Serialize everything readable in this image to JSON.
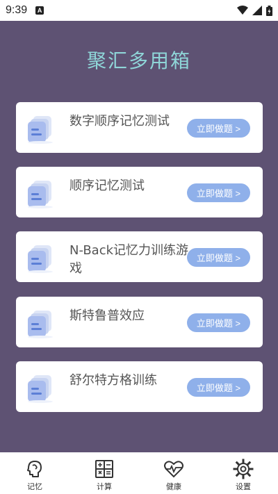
{
  "status": {
    "time": "9:39",
    "app_icon_letter": "A"
  },
  "title": "聚汇多用箱",
  "cards": [
    {
      "label": "数字顺序记忆测试",
      "button": "立即做题 >"
    },
    {
      "label": "顺序记忆测试",
      "button": "立即做题 >"
    },
    {
      "label": "N-Back记忆力训练游戏",
      "button": "立即做题 >"
    },
    {
      "label": "斯特鲁普效应",
      "button": "立即做题 >"
    },
    {
      "label": "舒尔特方格训练",
      "button": "立即做题 >"
    }
  ],
  "nav": [
    {
      "label": "记忆",
      "icon": "brain-icon",
      "active": true
    },
    {
      "label": "计算",
      "icon": "calculator-icon",
      "active": false
    },
    {
      "label": "健康",
      "icon": "heart-pulse-icon",
      "active": false
    },
    {
      "label": "设置",
      "icon": "gear-icon",
      "active": false
    }
  ],
  "colors": {
    "background": "#5e5273",
    "title": "#8fd6d8",
    "button": "#8fb0ea",
    "card": "#ffffff"
  }
}
